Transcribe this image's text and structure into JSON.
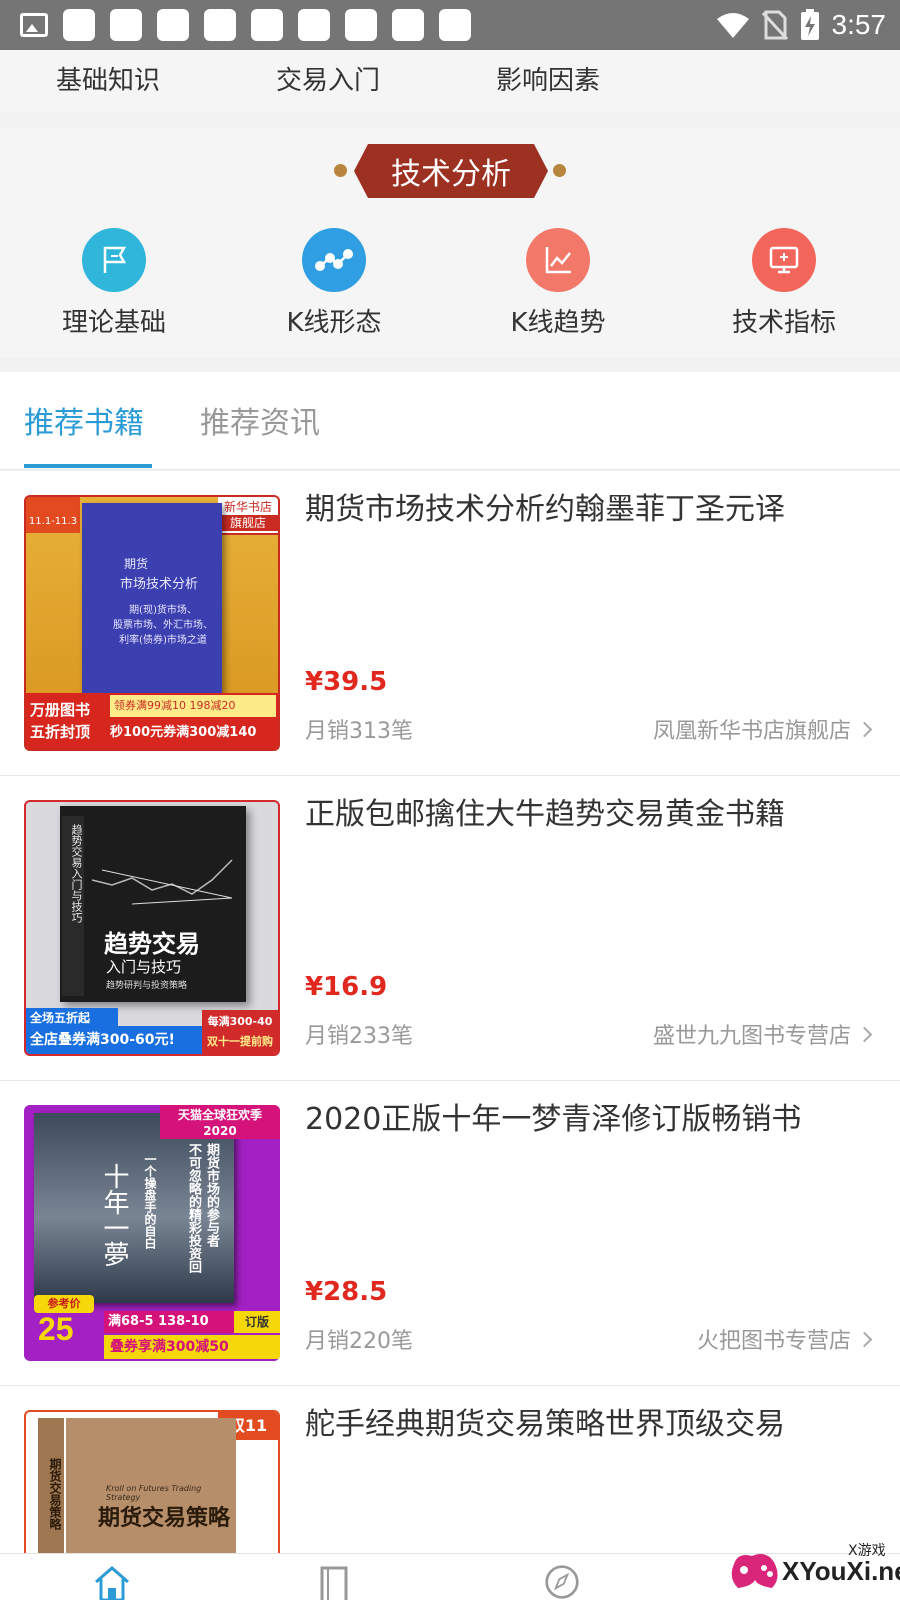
{
  "status_bar": {
    "time": "3:57"
  },
  "top_nav": {
    "items": [
      "基础知识",
      "交易入门",
      "影响因素"
    ]
  },
  "tech_section": {
    "banner": "技术分析",
    "categories": [
      {
        "label": "理论基础",
        "icon": "flag-icon",
        "color": "#2fb6da"
      },
      {
        "label": "K线形态",
        "icon": "nodes-icon",
        "color": "#2f9ee2"
      },
      {
        "label": "K线趋势",
        "icon": "trend-chart-icon",
        "color": "#f2796a"
      },
      {
        "label": "技术指标",
        "icon": "monitor-icon",
        "color": "#f2665c"
      }
    ]
  },
  "tabs": [
    {
      "label": "推荐书籍",
      "active": true
    },
    {
      "label": "推荐资讯",
      "active": false
    }
  ],
  "books": [
    {
      "title": "期货市场技术分析约翰墨菲丁圣元译",
      "price": "¥39.5",
      "sales": "月销313笔",
      "shop": "凤凰新华书店旗舰店",
      "cover": {
        "bg": "#e4a628",
        "book_color": "#3b3fb0",
        "store_badge": "新华书店",
        "store_badge_sub": "旗舰店",
        "event_badge": "11.1-11.3",
        "book_title_1": "期货",
        "book_title_2": "市场技术分析",
        "book_lines": [
          "期(现)货市场、",
          "股票市场、外汇市场、",
          "利率(债券)市场之道"
        ],
        "promo_left_1": "万册图书",
        "promo_left_2": "五折封顶",
        "promo_right_1": "领券满99减10 198减20",
        "promo_right_2": "秒100元券满300减140"
      }
    },
    {
      "title": "正版包邮擒住大牛趋势交易黄金书籍",
      "price": "¥16.9",
      "sales": "月销233笔",
      "shop": "盛世九九图书专营店",
      "cover": {
        "bg": "#dadade",
        "book_color": "#1c1c1c",
        "spine_text": "趋势交易入门与技巧",
        "main_title": "趋势交易",
        "sub_title": "入门与技巧",
        "small_title": "趋势研判与投资策略",
        "promo_top": "全场五折起",
        "promo_bottom": "全店叠券满300-60元!",
        "promo_right_1": "每满300-40",
        "promo_right_2": "双十一提前购"
      }
    },
    {
      "title": "2020正版十年一梦青泽修订版畅销书",
      "price": "¥28.5",
      "sales": "月销220笔",
      "shop": "火把图书专营店",
      "cover": {
        "bg": "#a321c4",
        "top_badge": "天猫全球狂欢季",
        "top_badge_sub": "2020",
        "calligraphy": "十年一夢",
        "vertical_1": "期货市场的参与者",
        "vertical_2": "不可忽略的精彩投资回",
        "vertical_3": "一个操盘手的自白",
        "ref_label": "参考价",
        "ref_price": "25",
        "promo_1": "满68-5 138-10",
        "promo_2": "叠券享满300减50",
        "edition": "订版"
      }
    },
    {
      "title": "舵手经典期货交易策略世界顶级交易",
      "cover": {
        "bg": "#ffffff",
        "badge": "双11",
        "en_title": "Kroll on Futures Trading Strategy",
        "main_title": "期货交易策略",
        "spine_text": "期货交易策略"
      }
    }
  ],
  "watermark": {
    "text": "XYouXi.net",
    "small": "X游戏"
  }
}
